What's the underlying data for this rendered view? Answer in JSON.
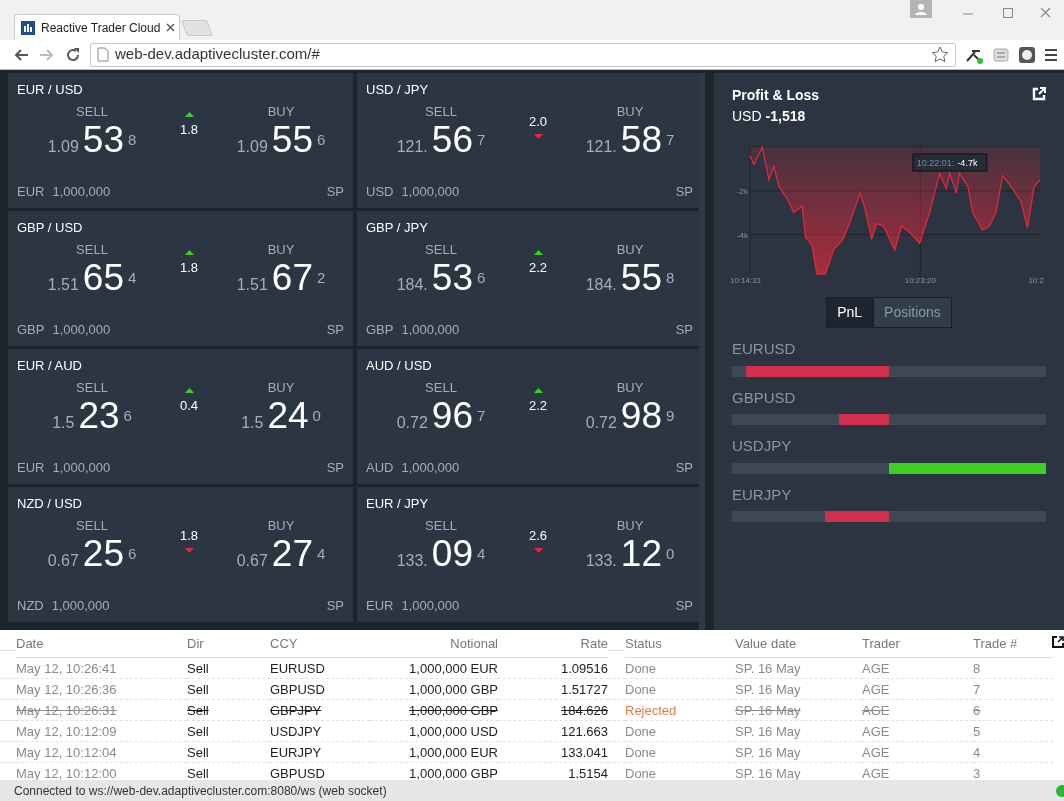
{
  "browser": {
    "tab": {
      "title": "Reactive Trader Cloud"
    },
    "address": "web-dev.adaptivecluster.com/#"
  },
  "tiles": [
    {
      "pair": "EUR / USD",
      "sell": {
        "label": "SELL",
        "big": "1.09",
        "pips": "53",
        "frac": "8"
      },
      "buy": {
        "label": "BUY",
        "big": "1.09",
        "pips": "55",
        "frac": "6"
      },
      "spread": "1.8",
      "rising": true,
      "currency": "EUR",
      "notional": "1,000,000",
      "tenor": "SP"
    },
    {
      "pair": "USD / JPY",
      "sell": {
        "label": "SELL",
        "big": "121.",
        "pips": "56",
        "frac": "7"
      },
      "buy": {
        "label": "BUY",
        "big": "121.",
        "pips": "58",
        "frac": "7"
      },
      "spread": "2.0",
      "rising": false,
      "currency": "USD",
      "notional": "1,000,000",
      "tenor": "SP"
    },
    {
      "pair": "GBP / USD",
      "sell": {
        "label": "SELL",
        "big": "1.51",
        "pips": "65",
        "frac": "4"
      },
      "buy": {
        "label": "BUY",
        "big": "1.51",
        "pips": "67",
        "frac": "2"
      },
      "spread": "1.8",
      "rising": true,
      "currency": "GBP",
      "notional": "1,000,000",
      "tenor": "SP"
    },
    {
      "pair": "GBP / JPY",
      "sell": {
        "label": "SELL",
        "big": "184.",
        "pips": "53",
        "frac": "6"
      },
      "buy": {
        "label": "BUY",
        "big": "184.",
        "pips": "55",
        "frac": "8"
      },
      "spread": "2.2",
      "rising": true,
      "currency": "GBP",
      "notional": "1,000,000",
      "tenor": "SP"
    },
    {
      "pair": "EUR / AUD",
      "sell": {
        "label": "SELL",
        "big": "1.5",
        "pips": "23",
        "frac": "6"
      },
      "buy": {
        "label": "BUY",
        "big": "1.5",
        "pips": "24",
        "frac": "0"
      },
      "spread": "0.4",
      "rising": true,
      "currency": "EUR",
      "notional": "1,000,000",
      "tenor": "SP"
    },
    {
      "pair": "AUD / USD",
      "sell": {
        "label": "SELL",
        "big": "0.72",
        "pips": "96",
        "frac": "7"
      },
      "buy": {
        "label": "BUY",
        "big": "0.72",
        "pips": "98",
        "frac": "9"
      },
      "spread": "2.2",
      "rising": true,
      "currency": "AUD",
      "notional": "1,000,000",
      "tenor": "SP"
    },
    {
      "pair": "NZD / USD",
      "sell": {
        "label": "SELL",
        "big": "0.67",
        "pips": "25",
        "frac": "6"
      },
      "buy": {
        "label": "BUY",
        "big": "0.67",
        "pips": "27",
        "frac": "4"
      },
      "spread": "1.8",
      "rising": false,
      "currency": "NZD",
      "notional": "1,000,000",
      "tenor": "SP"
    },
    {
      "pair": "EUR / JPY",
      "sell": {
        "label": "SELL",
        "big": "133.",
        "pips": "09",
        "frac": "4"
      },
      "buy": {
        "label": "BUY",
        "big": "133.",
        "pips": "12",
        "frac": "0"
      },
      "spread": "2.6",
      "rising": false,
      "currency": "EUR",
      "notional": "1,000,000",
      "tenor": "SP"
    }
  ],
  "pnl": {
    "title": "Profit & Loss",
    "currency": "USD",
    "value": "-1,518",
    "chart": {
      "y_labels": [
        "-2k",
        "-4k"
      ],
      "x_labels": [
        "10:14:31",
        "10:23:20",
        "10:2"
      ],
      "tooltip": {
        "time": "10:22:01:",
        "value": "-4.7k"
      }
    }
  },
  "toggle": [
    {
      "label": "PnL",
      "selected": true
    },
    {
      "label": "Positions",
      "selected": false
    }
  ],
  "positions": [
    {
      "symbol": "EURUSD",
      "negative": true
    },
    {
      "symbol": "GBPUSD",
      "negative": true
    },
    {
      "symbol": "USDJPY",
      "negative": false
    },
    {
      "symbol": "EURJPY",
      "negative": true
    }
  ],
  "blotter": {
    "columns": [
      "Date",
      "Dir",
      "CCY",
      "Notional",
      "Rate",
      "Status",
      "Value date",
      "Trader",
      "Trade #"
    ],
    "rows": [
      {
        "rejected": false,
        "cells": [
          "May 12, 10:26:41",
          "Sell",
          "EURUSD",
          "1,000,000 EUR",
          "1.09516",
          "Done",
          "SP. 16 May",
          "AGE",
          "8"
        ]
      },
      {
        "rejected": false,
        "cells": [
          "May 12, 10:26:36",
          "Sell",
          "GBPUSD",
          "1,000,000 GBP",
          "1.51727",
          "Done",
          "SP. 16 May",
          "AGE",
          "7"
        ]
      },
      {
        "rejected": true,
        "cells": [
          "May 12, 10:26:31",
          "Sell",
          "GBPJPY",
          "1,000,000 GBP",
          "184.626",
          "Rejected",
          "SP. 16 May",
          "AGE",
          "6"
        ]
      },
      {
        "rejected": false,
        "cells": [
          "May 12, 10:12:09",
          "Sell",
          "USDJPY",
          "1,000,000 USD",
          "121.663",
          "Done",
          "SP. 16 May",
          "AGE",
          "5"
        ]
      },
      {
        "rejected": false,
        "cells": [
          "May 12, 10:12:04",
          "Sell",
          "EURJPY",
          "1,000,000 EUR",
          "133.041",
          "Done",
          "SP. 16 May",
          "AGE",
          "4"
        ]
      },
      {
        "rejected": false,
        "cells": [
          "May 12, 10:12:00",
          "Sell",
          "GBPUSD",
          "1,000,000 GBP",
          "1.5154",
          "Done",
          "SP. 16 May",
          "AGE",
          "3"
        ]
      }
    ]
  },
  "status_bar": {
    "text": "Connected to ws://web-dev.adaptivecluster.com:8080/ws (web socket)",
    "connected": true
  }
}
